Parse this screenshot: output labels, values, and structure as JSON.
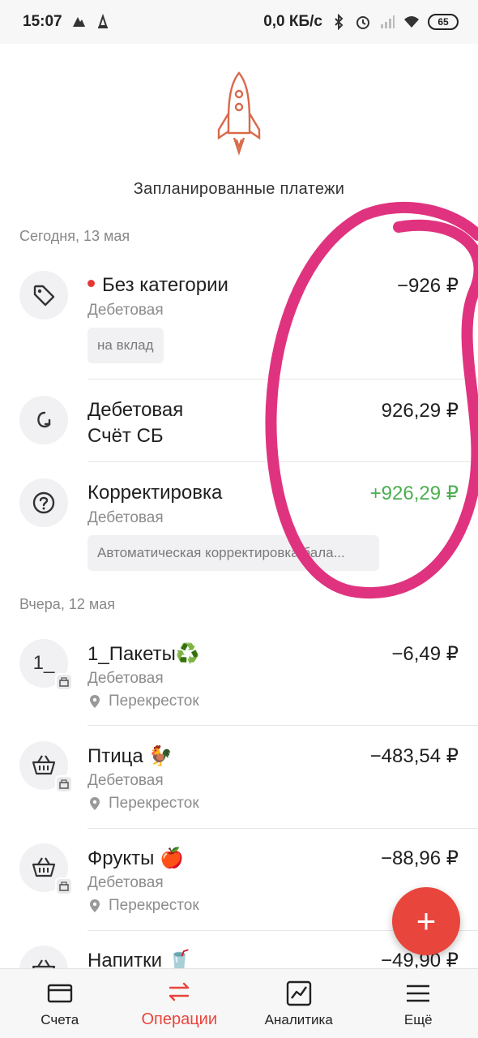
{
  "status_bar": {
    "time": "15:07",
    "net_speed": "0,0 КБ/с",
    "battery": "65",
    "icons": [
      "notification-icon",
      "vpn-icon",
      "bluetooth-icon",
      "alarm-icon",
      "signal-icon",
      "wifi-icon"
    ]
  },
  "hero": {
    "icon": "rocket-icon",
    "planned_label": "Запланированные платежи"
  },
  "sections": [
    {
      "date": "Сегодня, 13 мая"
    },
    {
      "date": "Вчера, 12 мая"
    }
  ],
  "today_ops": [
    {
      "icon": "tag-icon",
      "title": "Без категории",
      "subtitle": "Дебетовая",
      "chip": "на вклад",
      "amount": "−926 ₽",
      "dot": true
    },
    {
      "icon": "transfer-icon",
      "title": "Дебетовая",
      "title2": "Счёт СБ",
      "amount": "926,29 ₽"
    },
    {
      "icon": "question-icon",
      "title": "Корректировка",
      "subtitle": "Дебетовая",
      "chip": "Автоматическая корректировка бала...",
      "amount": "+926,29 ₽",
      "amount_color": "#4caf50"
    }
  ],
  "yesterday_ops": [
    {
      "icon_text": "1_",
      "title": "1_Пакеты♻️",
      "subtitle": "Дебетовая",
      "place": "Перекресток",
      "amount": "−6,49 ₽"
    },
    {
      "icon": "basket-icon",
      "title": "Птица 🐓",
      "subtitle": "Дебетовая",
      "place": "Перекресток",
      "amount": "−483,54 ₽"
    },
    {
      "icon": "basket-icon",
      "title": "Фрукты 🍎",
      "subtitle": "Дебетовая",
      "place": "Перекресток",
      "amount": "−88,96 ₽"
    },
    {
      "icon": "basket-icon",
      "title": "Напитки 🥤",
      "amount": "−49,90 ₽"
    }
  ],
  "fab": {
    "label": "+"
  },
  "nav": [
    {
      "icon": "card-icon",
      "label": "Счета"
    },
    {
      "icon": "arrows-icon",
      "label": "Операции",
      "active": true
    },
    {
      "icon": "chart-icon",
      "label": "Аналитика"
    },
    {
      "icon": "menu-icon",
      "label": "Ещё"
    }
  ],
  "colors": {
    "accent": "#e8453c",
    "positive": "#4caf50",
    "annotation": "#e0337f"
  }
}
